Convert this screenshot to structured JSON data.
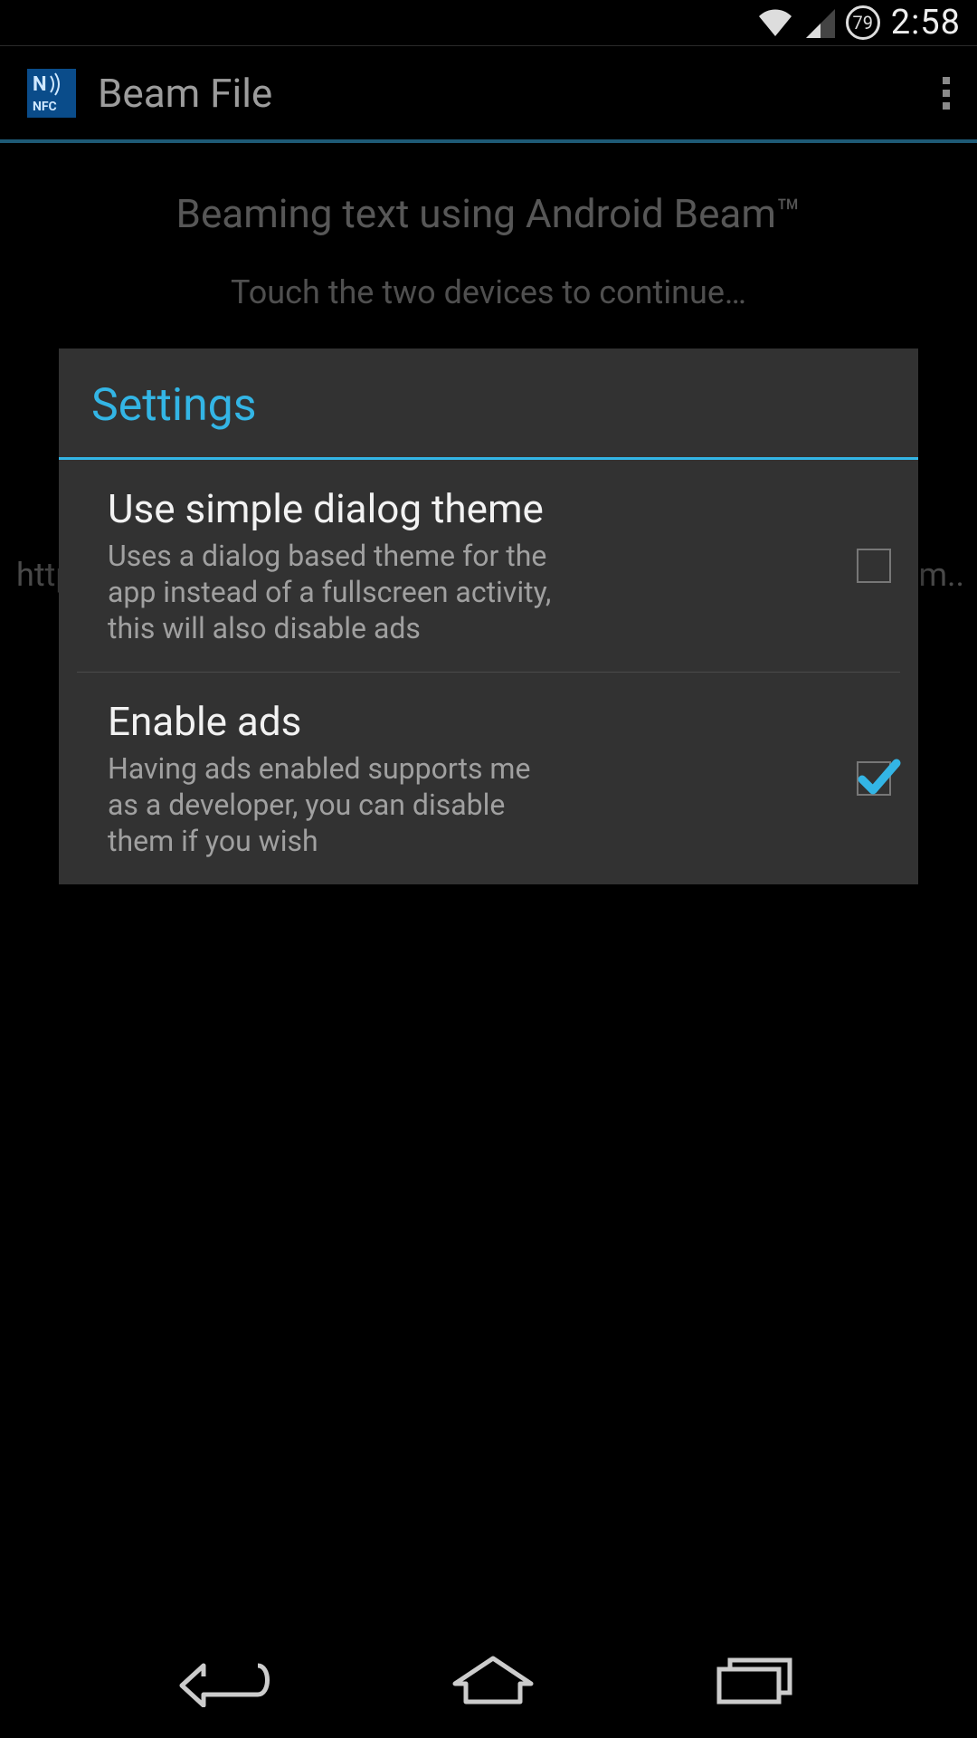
{
  "status": {
    "battery": "79",
    "time": "2:58"
  },
  "actionbar": {
    "app_icon_label": "NFC",
    "title": "Beam File"
  },
  "backdrop": {
    "heading": "Beaming text using Android Beam™",
    "subtitle": "Touch the two devices to continue…",
    "url_left": "http",
    "url_right": ".m.."
  },
  "dialog": {
    "title": "Settings",
    "items": [
      {
        "title": "Use simple dialog theme",
        "desc": "Uses a dialog based theme for the app instead of a fullscreen activity, this will also disable ads",
        "checked": false
      },
      {
        "title": "Enable ads",
        "desc": "Having ads enabled supports me as a developer, you can disable them if you wish",
        "checked": true
      }
    ]
  }
}
